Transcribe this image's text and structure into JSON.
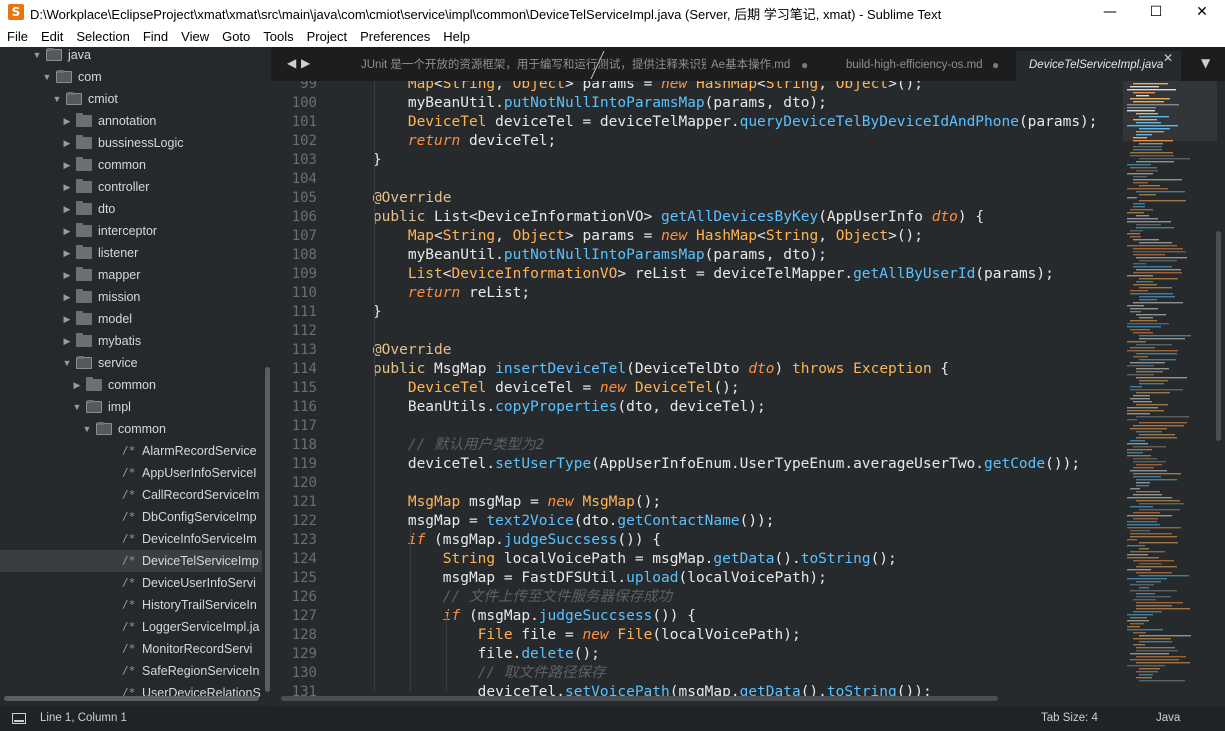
{
  "window": {
    "title": "D:\\Workplace\\EclipseProject\\xmat\\xmat\\src\\main\\java\\com\\cmiot\\service\\impl\\common\\DeviceTelServiceImpl.java (Server, 后期 学习笔记, xmat) - Sublime Text",
    "app_icon_letter": "S",
    "minimize": "—",
    "maximize": "☐",
    "close": "✕"
  },
  "menu": [
    "File",
    "Edit",
    "Selection",
    "Find",
    "View",
    "Goto",
    "Tools",
    "Project",
    "Preferences",
    "Help"
  ],
  "sidebar": {
    "rows": [
      {
        "label": "java",
        "kind": "folder-open",
        "depth": 0
      },
      {
        "label": "com",
        "kind": "folder-open",
        "depth": 1
      },
      {
        "label": "cmiot",
        "kind": "folder-open",
        "depth": 2
      },
      {
        "label": "annotation",
        "kind": "folder",
        "depth": 3
      },
      {
        "label": "bussinessLogic",
        "kind": "folder",
        "depth": 3
      },
      {
        "label": "common",
        "kind": "folder",
        "depth": 3
      },
      {
        "label": "controller",
        "kind": "folder",
        "depth": 3
      },
      {
        "label": "dto",
        "kind": "folder",
        "depth": 3
      },
      {
        "label": "interceptor",
        "kind": "folder",
        "depth": 3
      },
      {
        "label": "listener",
        "kind": "folder",
        "depth": 3
      },
      {
        "label": "mapper",
        "kind": "folder",
        "depth": 3
      },
      {
        "label": "mission",
        "kind": "folder",
        "depth": 3
      },
      {
        "label": "model",
        "kind": "folder",
        "depth": 3
      },
      {
        "label": "mybatis",
        "kind": "folder",
        "depth": 3
      },
      {
        "label": "service",
        "kind": "folder-open",
        "depth": 3
      },
      {
        "label": "common",
        "kind": "folder",
        "depth": 4
      },
      {
        "label": "impl",
        "kind": "folder-open",
        "depth": 4
      },
      {
        "label": "common",
        "kind": "folder-open",
        "depth": 5
      },
      {
        "label": "AlarmRecordService",
        "kind": "file",
        "depth": 6
      },
      {
        "label": "AppUserInfoServiceI",
        "kind": "file",
        "depth": 6
      },
      {
        "label": "CallRecordServiceIm",
        "kind": "file",
        "depth": 6
      },
      {
        "label": "DbConfigServiceImp",
        "kind": "file",
        "depth": 6
      },
      {
        "label": "DeviceInfoServiceIm",
        "kind": "file",
        "depth": 6
      },
      {
        "label": "DeviceTelServiceImp",
        "kind": "file",
        "depth": 6,
        "selected": true
      },
      {
        "label": "DeviceUserInfoServi",
        "kind": "file",
        "depth": 6
      },
      {
        "label": "HistoryTrailServiceIn",
        "kind": "file",
        "depth": 6
      },
      {
        "label": "LoggerServiceImpl.ja",
        "kind": "file",
        "depth": 6
      },
      {
        "label": "MonitorRecordServi",
        "kind": "file",
        "depth": 6
      },
      {
        "label": "SafeRegionServiceIn",
        "kind": "file",
        "depth": 6
      },
      {
        "label": "UserDeviceRelationS",
        "kind": "file",
        "depth": 6
      }
    ],
    "folder_closed_arrow": "▶",
    "folder_open_arrow": "▼",
    "file_icon": "/*"
  },
  "tabs": {
    "nav_left": "◀",
    "nav_right": "▶",
    "overflow": "▼",
    "close_icon": "✕",
    "dirty_dot": "●",
    "items": [
      {
        "label": "JUnit 是一个开放的资源框架，用于编写和运行测试，提供注释来识别",
        "dirty": false
      },
      {
        "label": "Ae基本操作.md",
        "dirty": true
      },
      {
        "label": "build-high-efficiency-os.md",
        "dirty": true
      },
      {
        "label": "DeviceTelServiceImpl.java",
        "active": true
      }
    ]
  },
  "editor": {
    "line_numbers": [
      "99",
      "100",
      "101",
      "102",
      "103",
      "104",
      "105",
      "106",
      "107",
      "108",
      "109",
      "110",
      "111",
      "112",
      "113",
      "114",
      "115",
      "116",
      "117",
      "118",
      "119",
      "120",
      "121",
      "122",
      "123",
      "124",
      "125",
      "126",
      "127",
      "128",
      "129",
      "130",
      "131"
    ],
    "lines": [
      [
        [
          "t",
          "        "
        ],
        [
          "k",
          "Map"
        ],
        [
          "t",
          "<"
        ],
        [
          "k",
          "String"
        ],
        [
          "t",
          ", "
        ],
        [
          "k",
          "Object"
        ],
        [
          "t",
          "> params = "
        ],
        [
          "i",
          "new"
        ],
        [
          "t",
          " "
        ],
        [
          "k",
          "HashMap"
        ],
        [
          "t",
          "<"
        ],
        [
          "k",
          "String"
        ],
        [
          "t",
          ", "
        ],
        [
          "k",
          "Object"
        ],
        [
          "t",
          ">();"
        ]
      ],
      [
        [
          "t",
          "        myBeanUtil."
        ],
        [
          "f",
          "putNotNullIntoParamsMap"
        ],
        [
          "t",
          "(params, dto);"
        ]
      ],
      [
        [
          "t",
          "        "
        ],
        [
          "k",
          "DeviceTel"
        ],
        [
          "t",
          " deviceTel = deviceTelMapper."
        ],
        [
          "f",
          "queryDeviceTelByDeviceIdAndPhone"
        ],
        [
          "t",
          "(params);"
        ]
      ],
      [
        [
          "t",
          "        "
        ],
        [
          "i",
          "return"
        ],
        [
          "t",
          " deviceTel;"
        ]
      ],
      [
        [
          "t",
          "    }"
        ]
      ],
      [
        [
          "t",
          ""
        ]
      ],
      [
        [
          "t",
          "    "
        ],
        [
          "an",
          "@Override"
        ]
      ],
      [
        [
          "t",
          "    "
        ],
        [
          "an",
          "public"
        ],
        [
          "t",
          " List<"
        ],
        [
          "t",
          "DeviceInformationVO"
        ],
        [
          "t",
          "> "
        ],
        [
          "f",
          "getAllDevicesByKey"
        ],
        [
          "t",
          "(AppUserInfo "
        ],
        [
          "i",
          "dto"
        ],
        [
          "t",
          ") {"
        ]
      ],
      [
        [
          "t",
          "        "
        ],
        [
          "k",
          "Map"
        ],
        [
          "t",
          "<"
        ],
        [
          "k",
          "String"
        ],
        [
          "t",
          ", "
        ],
        [
          "k",
          "Object"
        ],
        [
          "t",
          "> params = "
        ],
        [
          "i",
          "new"
        ],
        [
          "t",
          " "
        ],
        [
          "k",
          "HashMap"
        ],
        [
          "t",
          "<"
        ],
        [
          "k",
          "String"
        ],
        [
          "t",
          ", "
        ],
        [
          "k",
          "Object"
        ],
        [
          "t",
          ">();"
        ]
      ],
      [
        [
          "t",
          "        myBeanUtil."
        ],
        [
          "f",
          "putNotNullIntoParamsMap"
        ],
        [
          "t",
          "(params, dto);"
        ]
      ],
      [
        [
          "t",
          "        "
        ],
        [
          "k",
          "List"
        ],
        [
          "t",
          "<"
        ],
        [
          "k",
          "DeviceInformationVO"
        ],
        [
          "t",
          "> reList = deviceTelMapper."
        ],
        [
          "f",
          "getAllByUserId"
        ],
        [
          "t",
          "(params);"
        ]
      ],
      [
        [
          "t",
          "        "
        ],
        [
          "i",
          "return"
        ],
        [
          "t",
          " reList;"
        ]
      ],
      [
        [
          "t",
          "    }"
        ]
      ],
      [
        [
          "t",
          ""
        ]
      ],
      [
        [
          "t",
          "    "
        ],
        [
          "an",
          "@Override"
        ]
      ],
      [
        [
          "t",
          "    "
        ],
        [
          "an",
          "public"
        ],
        [
          "t",
          " MsgMap "
        ],
        [
          "f",
          "insertDeviceTel"
        ],
        [
          "t",
          "(DeviceTelDto "
        ],
        [
          "i",
          "dto"
        ],
        [
          "t",
          ") "
        ],
        [
          "k",
          "throws"
        ],
        [
          "t",
          " "
        ],
        [
          "k",
          "Exception"
        ],
        [
          "t",
          " {"
        ]
      ],
      [
        [
          "t",
          "        "
        ],
        [
          "k",
          "DeviceTel"
        ],
        [
          "t",
          " deviceTel = "
        ],
        [
          "i",
          "new"
        ],
        [
          "t",
          " "
        ],
        [
          "k",
          "DeviceTel"
        ],
        [
          "t",
          "();"
        ]
      ],
      [
        [
          "t",
          "        BeanUtils."
        ],
        [
          "f",
          "copyProperties"
        ],
        [
          "t",
          "(dto, deviceTel);"
        ]
      ],
      [
        [
          "t",
          ""
        ]
      ],
      [
        [
          "t",
          "        "
        ],
        [
          "c",
          "// 默认用户类型为2"
        ]
      ],
      [
        [
          "t",
          "        deviceTel."
        ],
        [
          "f",
          "setUserType"
        ],
        [
          "t",
          "(AppUserInfoEnum.UserTypeEnum.averageUserTwo."
        ],
        [
          "f",
          "getCode"
        ],
        [
          "t",
          "());"
        ]
      ],
      [
        [
          "t",
          ""
        ]
      ],
      [
        [
          "t",
          "        "
        ],
        [
          "k",
          "MsgMap"
        ],
        [
          "t",
          " msgMap = "
        ],
        [
          "i",
          "new"
        ],
        [
          "t",
          " "
        ],
        [
          "k",
          "MsgMap"
        ],
        [
          "t",
          "();"
        ]
      ],
      [
        [
          "t",
          "        msgMap = "
        ],
        [
          "f",
          "text2Voice"
        ],
        [
          "t",
          "(dto."
        ],
        [
          "f",
          "getContactName"
        ],
        [
          "t",
          "());"
        ]
      ],
      [
        [
          "t",
          "        "
        ],
        [
          "i",
          "if"
        ],
        [
          "t",
          " (msgMap."
        ],
        [
          "f",
          "judgeSuccsess"
        ],
        [
          "t",
          "()) {"
        ]
      ],
      [
        [
          "t",
          "            "
        ],
        [
          "k",
          "String"
        ],
        [
          "t",
          " localVoicePath = msgMap."
        ],
        [
          "f",
          "getData"
        ],
        [
          "t",
          "()."
        ],
        [
          "f",
          "toString"
        ],
        [
          "t",
          "();"
        ]
      ],
      [
        [
          "t",
          "            msgMap = FastDFSUtil."
        ],
        [
          "f",
          "upload"
        ],
        [
          "t",
          "(localVoicePath);"
        ]
      ],
      [
        [
          "t",
          "            "
        ],
        [
          "c",
          "// 文件上传至文件服务器保存成功"
        ]
      ],
      [
        [
          "t",
          "            "
        ],
        [
          "i",
          "if"
        ],
        [
          "t",
          " (msgMap."
        ],
        [
          "f",
          "judgeSuccsess"
        ],
        [
          "t",
          "()) {"
        ]
      ],
      [
        [
          "t",
          "                "
        ],
        [
          "k",
          "File"
        ],
        [
          "t",
          " file = "
        ],
        [
          "i",
          "new"
        ],
        [
          "t",
          " "
        ],
        [
          "k",
          "File"
        ],
        [
          "t",
          "(localVoicePath);"
        ]
      ],
      [
        [
          "t",
          "                file."
        ],
        [
          "f",
          "delete"
        ],
        [
          "t",
          "();"
        ]
      ],
      [
        [
          "t",
          "                "
        ],
        [
          "c",
          "// 取文件路径保存"
        ]
      ],
      [
        [
          "t",
          "                deviceTel."
        ],
        [
          "f",
          "setVoicePath"
        ],
        [
          "t",
          "(msgMap."
        ],
        [
          "f",
          "getData"
        ],
        [
          "t",
          "()."
        ],
        [
          "f",
          "toString"
        ],
        [
          "t",
          "());"
        ]
      ]
    ]
  },
  "status": {
    "position": "Line 1, Column 1",
    "tab_size": "Tab Size: 4",
    "syntax": "Java"
  },
  "colors": {
    "sidebar_bg": "#26292b",
    "editor_bg": "#272a2c",
    "keyword_type": "#ffb454",
    "function": "#59c2ff",
    "keyword_italic": "#ff8f40",
    "comment": "#5c6166"
  }
}
